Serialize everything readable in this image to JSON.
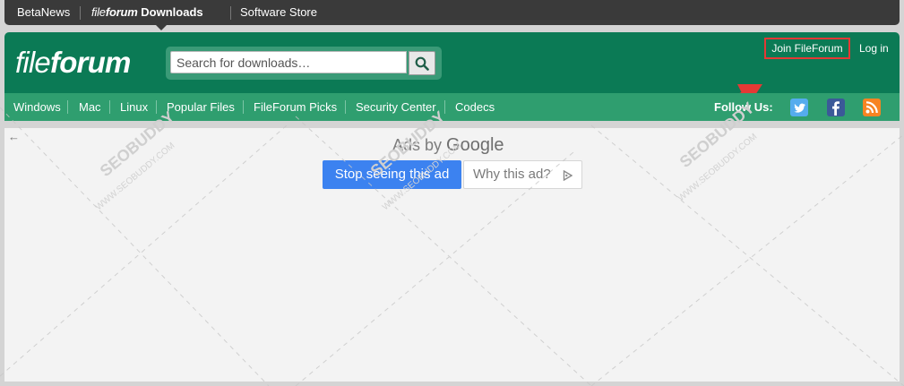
{
  "topbar": {
    "betanews": "BetaNews",
    "fileforum_light": "file",
    "fileforum_bold": "forum",
    "downloads": "Downloads",
    "software_store": "Software Store"
  },
  "header": {
    "logo_light": "file",
    "logo_bold": "forum",
    "search_placeholder": "Search for downloads…",
    "search_value": "",
    "join": "Join FileForum",
    "login": "Log in"
  },
  "nav": {
    "items": [
      "Windows",
      "Mac",
      "Linux",
      "Popular Files",
      "FileForum Picks",
      "Security Center",
      "Codecs"
    ],
    "follow_us": "Follow Us:"
  },
  "ad": {
    "ads_by": "Ads by",
    "google": "Google",
    "stop_button": "Stop seeing this ad",
    "why_button": "Why this ad?"
  },
  "watermark": {
    "brand": "SEOBUDDY",
    "url": "WWW.SEOBUDDY.COM"
  },
  "colors": {
    "header_green": "#0b7a55",
    "nav_green": "#2f9e6f",
    "highlight_red": "#e53935",
    "google_blue": "#3c82f0"
  },
  "icons": {
    "search": "search-icon",
    "twitter": "twitter-icon",
    "facebook": "facebook-icon",
    "rss": "rss-icon",
    "back": "back-arrow-icon",
    "adchoices": "adchoices-icon"
  }
}
